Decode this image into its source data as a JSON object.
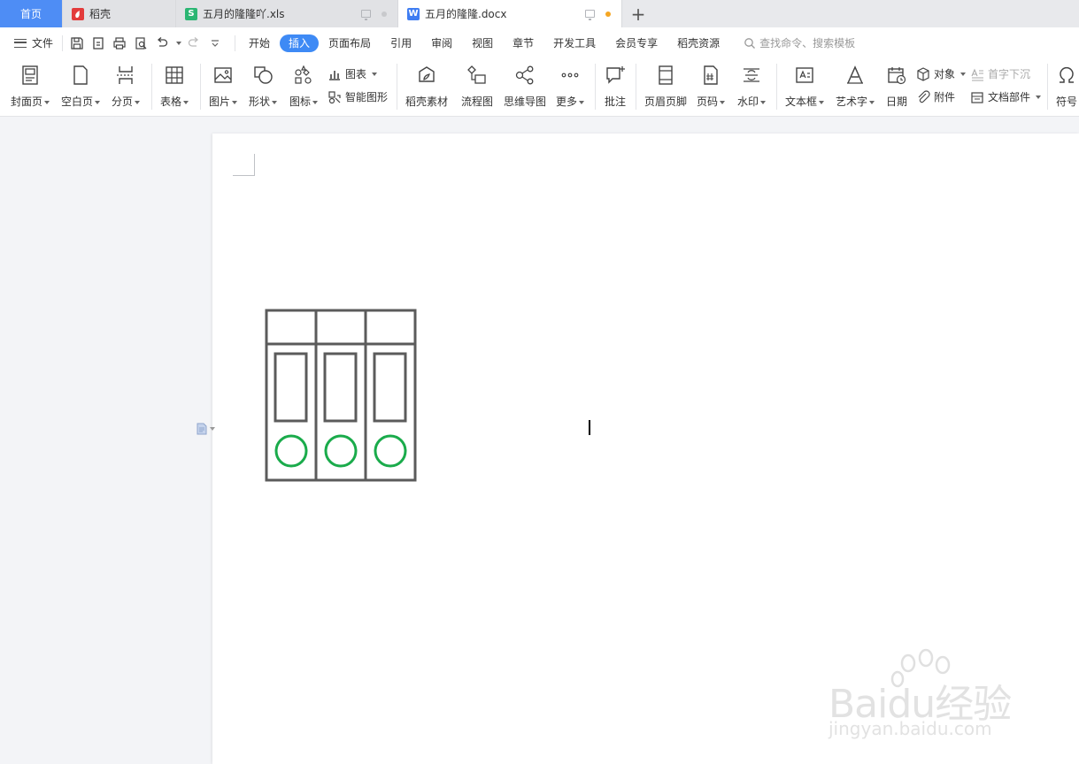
{
  "tabs": {
    "home": "首页",
    "daoke": "稻壳",
    "xls": "五月的隆隆吖.xls",
    "docx": "五月的隆隆.docx",
    "add": "+"
  },
  "menu": {
    "file": "文件",
    "items": [
      "开始",
      "插入",
      "页面布局",
      "引用",
      "审阅",
      "视图",
      "章节",
      "开发工具",
      "会员专享",
      "稻壳资源"
    ],
    "active": "插入",
    "search_placeholder": "查找命令、搜索模板"
  },
  "ribbon": {
    "cover": "封面页",
    "blank": "空白页",
    "pagebreak": "分页",
    "table": "表格",
    "picture": "图片",
    "shape": "形状",
    "icon": "图标",
    "chart": "图表",
    "smartart": "智能图形",
    "daoke_material": "稻壳素材",
    "flowchart": "流程图",
    "mindmap": "思维导图",
    "more": "更多",
    "comment": "批注",
    "header_footer": "页眉页脚",
    "page_number": "页码",
    "watermark": "水印",
    "textbox": "文本框",
    "wordart": "艺术字",
    "date": "日期",
    "object": "对象",
    "attachment": "附件",
    "dropcap": "首字下沉",
    "doc_parts": "文档部件",
    "symbol": "符号"
  },
  "watermark": {
    "brand": "Baidu经验",
    "url": "jingyan.baidu.com"
  },
  "colors": {
    "accent": "#3e8af5",
    "home_tab": "#4e8df5",
    "drawing_stroke": "#5b5b5b",
    "circle_green": "#1aab4b"
  }
}
